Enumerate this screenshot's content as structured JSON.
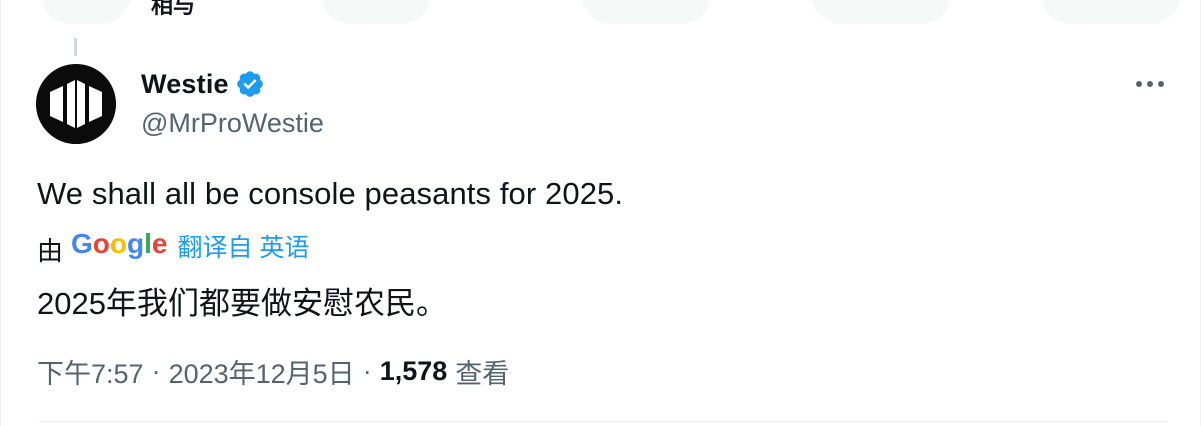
{
  "header_partial": {
    "text": "相与"
  },
  "tweet": {
    "display_name": "Westie",
    "handle": "@MrProWestie",
    "verified": true,
    "text": "We shall all be console peasants for 2025.",
    "translation": {
      "by_label": "由",
      "provider": "Google",
      "link_text": "翻译自 英语",
      "translated_text": "2025年我们都要做安慰农民。"
    },
    "meta": {
      "time": "下午7:57",
      "separator": "·",
      "date": "2023年12月5日",
      "views_count": "1,578",
      "views_label": "查看"
    }
  },
  "icons": {
    "verified": "verified-badge-icon",
    "more": "more-dots-icon"
  },
  "colors": {
    "accent": "#1d9bf0",
    "secondary_text": "#536471",
    "primary_text": "#0f1419"
  }
}
